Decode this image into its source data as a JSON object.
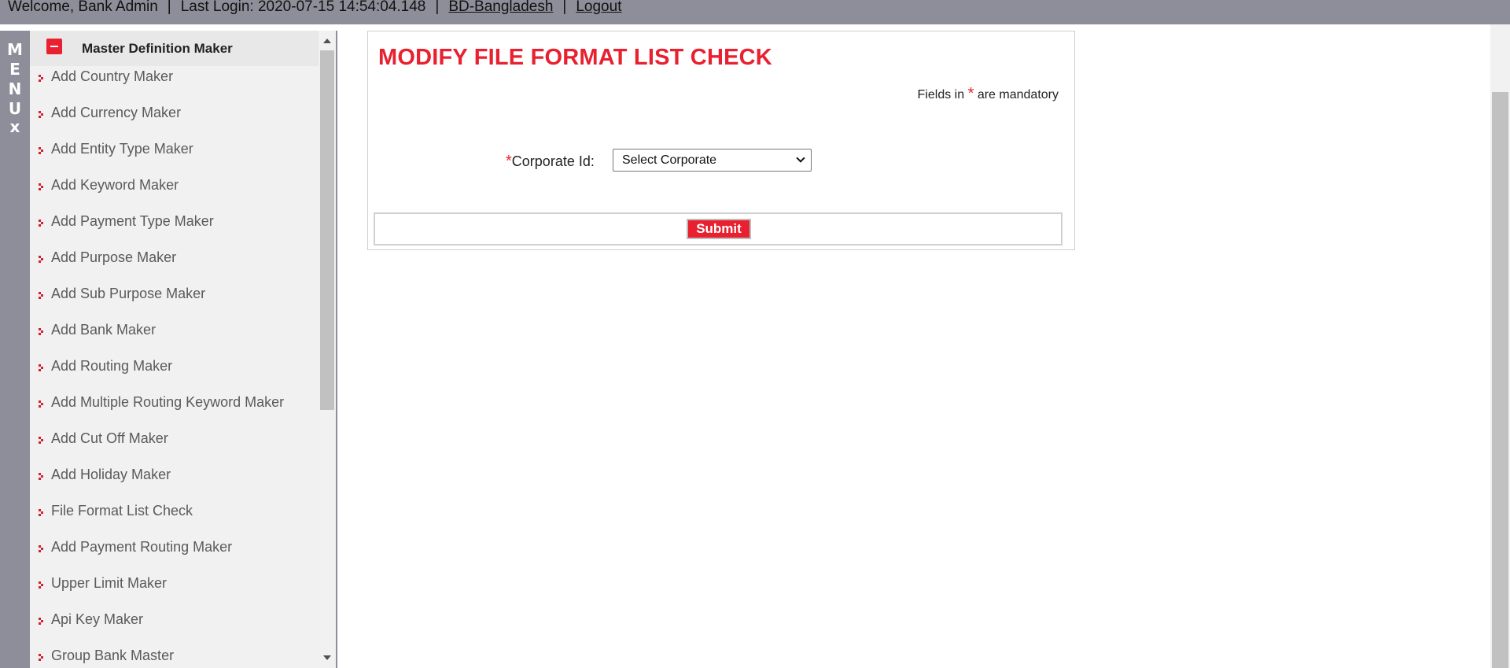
{
  "topbar": {
    "welcome": "Welcome, Bank Admin",
    "last_login": "Last Login: 2020-07-15 14:54:04.148",
    "country": "BD-Bangladesh",
    "logout": "Logout",
    "separator": "|"
  },
  "menu_strip": {
    "letters": [
      "M",
      "E",
      "N",
      "U"
    ],
    "close": "x"
  },
  "sidebar": {
    "header": "Master Definition Maker",
    "items": [
      {
        "label": "Add Country Maker"
      },
      {
        "label": "Add Currency Maker"
      },
      {
        "label": "Add Entity Type Maker"
      },
      {
        "label": "Add Keyword Maker"
      },
      {
        "label": "Add Payment Type Maker"
      },
      {
        "label": "Add Purpose Maker"
      },
      {
        "label": "Add Sub Purpose Maker"
      },
      {
        "label": "Add Bank Maker"
      },
      {
        "label": "Add Routing Maker"
      },
      {
        "label": "Add Multiple Routing Keyword Maker"
      },
      {
        "label": "Add Cut Off Maker"
      },
      {
        "label": "Add Holiday Maker"
      },
      {
        "label": "File Format List Check"
      },
      {
        "label": "Add Payment Routing Maker"
      },
      {
        "label": "Upper Limit Maker"
      },
      {
        "label": "Api Key Maker"
      },
      {
        "label": "Group Bank Master"
      }
    ]
  },
  "main": {
    "title": "MODIFY FILE FORMAT LIST CHECK",
    "mandatory_prefix": "Fields in",
    "mandatory_star": "*",
    "mandatory_suffix": "are mandatory",
    "field_star": "*",
    "field_label": "Corporate Id:",
    "select_value": "Select Corporate",
    "submit_label": "Submit"
  },
  "colors": {
    "accent": "#e8202f",
    "bar": "#8e8e9a"
  }
}
